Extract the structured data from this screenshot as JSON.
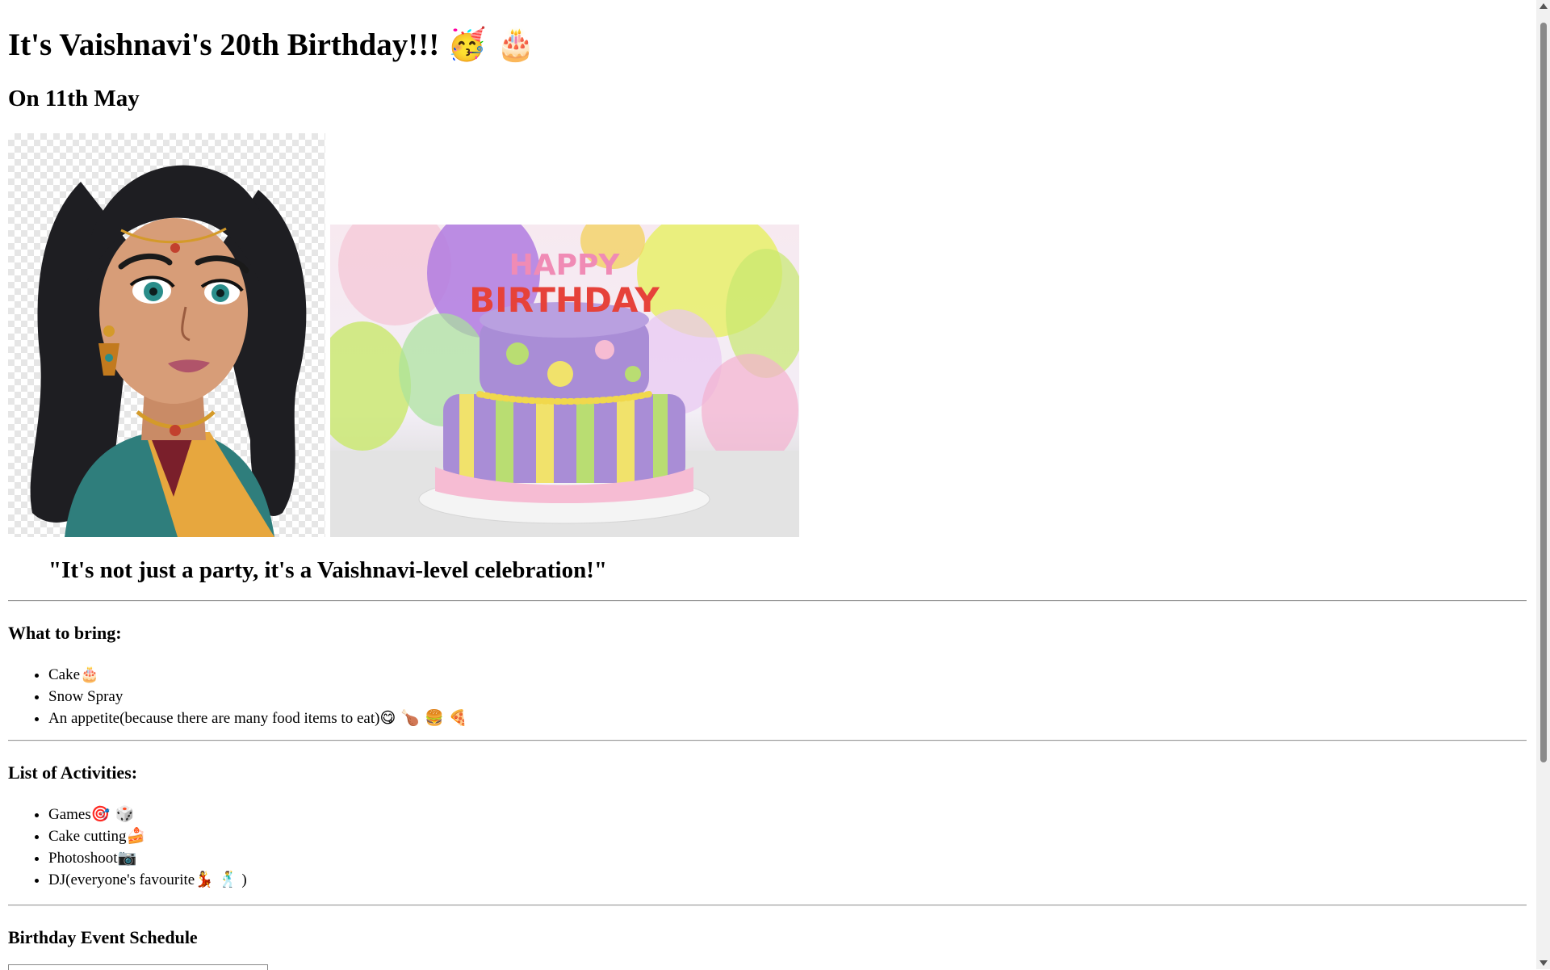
{
  "header": {
    "title": "It's Vaishnavi's 20th Birthday!!!",
    "title_emojis": "🥳 🎂",
    "date": "On 11th May"
  },
  "images": {
    "portrait": "Vaishnavi cartoon portrait",
    "cake_photo": "Happy Birthday cake with balloons",
    "cake_text_line1": "HAPPY",
    "cake_text_line2": "BIRTHDAY"
  },
  "quote": "\"It's not just a party, it's a Vaishnavi-level celebration!\"",
  "bring": {
    "heading": "What to bring:",
    "items": [
      {
        "text": "Cake",
        "emoji": "🎂"
      },
      {
        "text": "Snow Spray",
        "emoji": ""
      },
      {
        "text": "An appetite(because there are many food items to eat)",
        "emoji": "😋 🍗 🍔 🍕"
      }
    ]
  },
  "activities": {
    "heading": "List of Activities:",
    "items": [
      {
        "text": "Games",
        "emoji": "🎯 🎲"
      },
      {
        "text": "Cake cutting",
        "emoji": "🍰"
      },
      {
        "text": "Photoshoot",
        "emoji": "📷"
      },
      {
        "text": "DJ(everyone's favourite",
        "emoji": "💃 🕺",
        "suffix": " )"
      }
    ]
  },
  "schedule": {
    "heading": "Birthday Event Schedule"
  },
  "colors": {
    "rule": "#9a9a9a",
    "scroll_thumb": "#8a8a8a"
  }
}
